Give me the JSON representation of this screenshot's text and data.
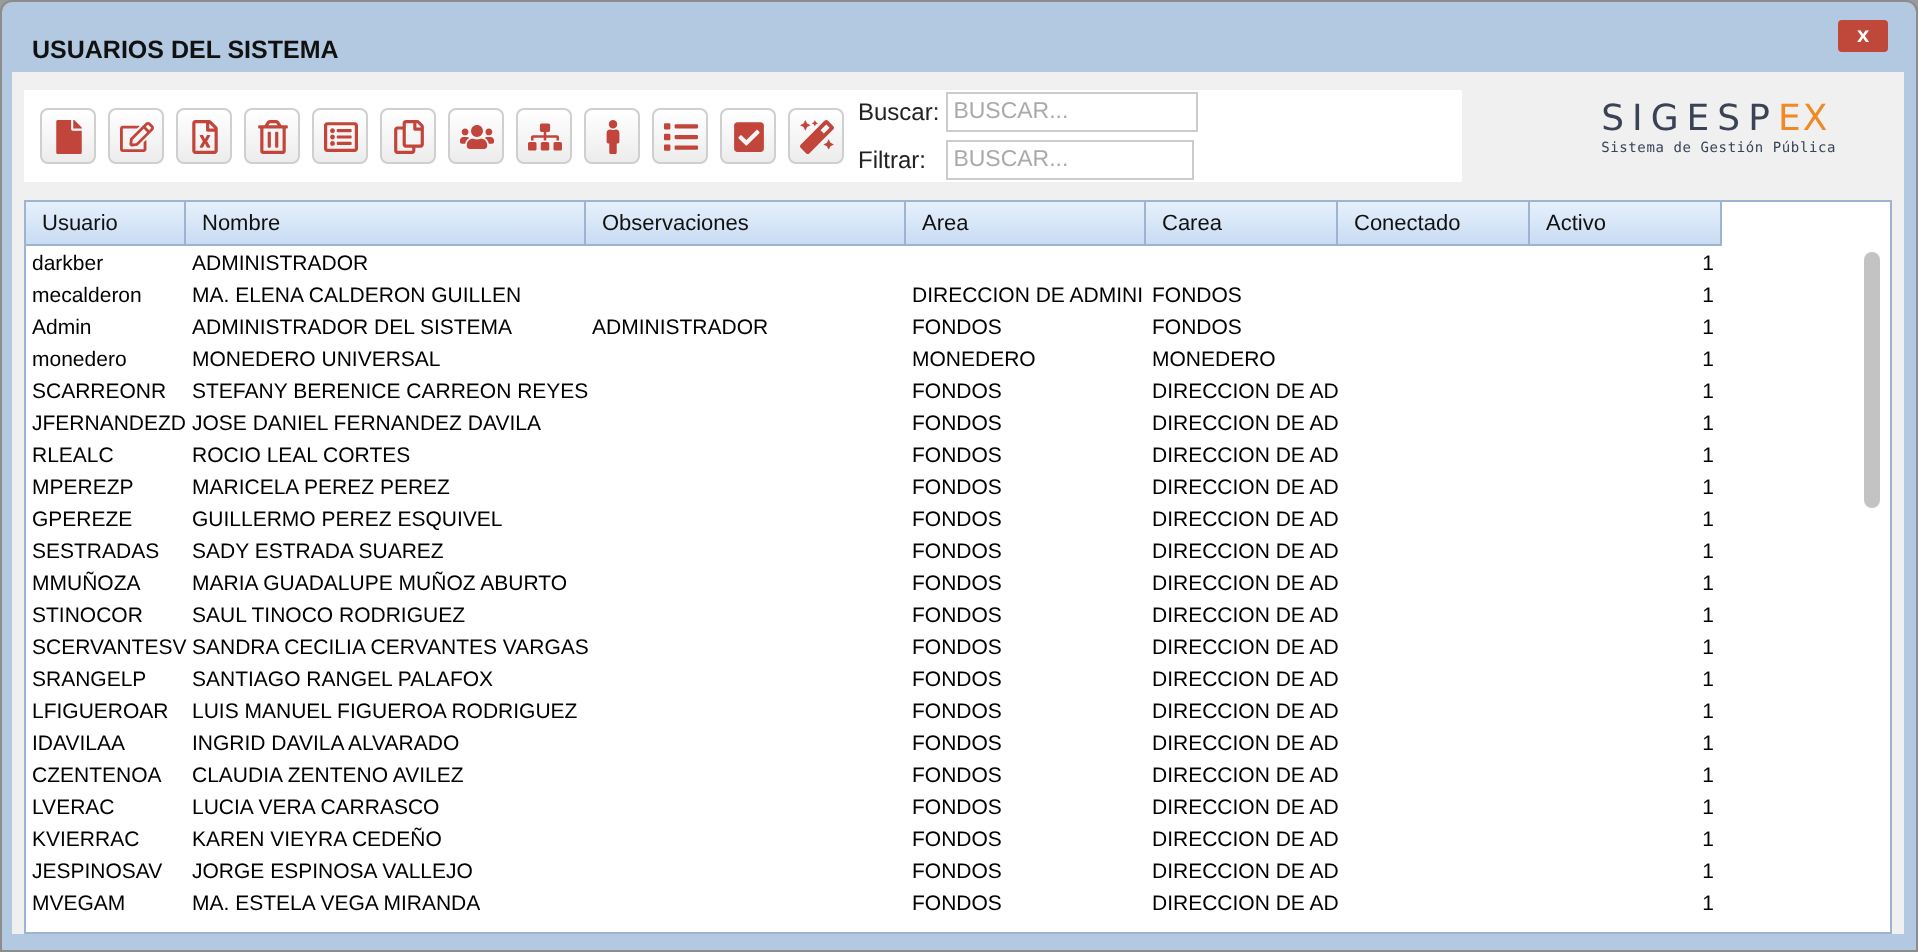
{
  "window": {
    "title": "USUARIOS DEL SISTEMA",
    "close": "x"
  },
  "toolbar": {
    "buttons": [
      {
        "kind": "new"
      },
      {
        "kind": "edit"
      },
      {
        "kind": "excel"
      },
      {
        "kind": "delete"
      },
      {
        "kind": "card"
      },
      {
        "kind": "copy"
      },
      {
        "kind": "users"
      },
      {
        "kind": "tree"
      },
      {
        "kind": "person"
      },
      {
        "kind": "list"
      },
      {
        "kind": "check"
      },
      {
        "kind": "wand"
      }
    ],
    "search": {
      "label": "Buscar:",
      "placeholder": "BUSCAR..."
    },
    "filter": {
      "label": "Filtrar:",
      "placeholder": "BUSCAR..."
    }
  },
  "logo": {
    "name": "SIGESP",
    "suffix": "EX",
    "tagline": "Sistema de Gestión Pública"
  },
  "table": {
    "columns": [
      "Usuario",
      "Nombre",
      "Observaciones",
      "Area",
      "Carea",
      "Conectado",
      "Activo"
    ],
    "rows": [
      {
        "usuario": "darkber",
        "nombre": "ADMINISTRADOR",
        "activo": "1"
      },
      {
        "usuario": "mecalderon",
        "nombre": "MA. ELENA CALDERON GUILLEN",
        "area": "DIRECCION DE ADMINI",
        "carea": "FONDOS",
        "activo": "1"
      },
      {
        "usuario": "Admin",
        "nombre": "ADMINISTRADOR DEL SISTEMA",
        "observaciones": "ADMINISTRADOR",
        "area": "FONDOS",
        "carea": "FONDOS",
        "activo": "1"
      },
      {
        "usuario": "monedero",
        "nombre": "MONEDERO UNIVERSAL",
        "area": "MONEDERO",
        "carea": "MONEDERO",
        "activo": "1"
      },
      {
        "usuario": "SCARREONR",
        "nombre": "STEFANY BERENICE CARREON REYES",
        "area": "FONDOS",
        "carea": "DIRECCION DE AD",
        "activo": "1"
      },
      {
        "usuario": "JFERNANDEZD",
        "nombre": "JOSE DANIEL FERNANDEZ DAVILA",
        "area": "FONDOS",
        "carea": "DIRECCION DE AD",
        "activo": "1"
      },
      {
        "usuario": "RLEALC",
        "nombre": "ROCIO LEAL CORTES",
        "area": "FONDOS",
        "carea": "DIRECCION DE AD",
        "activo": "1"
      },
      {
        "usuario": "MPEREZP",
        "nombre": "MARICELA PEREZ PEREZ",
        "area": "FONDOS",
        "carea": "DIRECCION DE AD",
        "activo": "1"
      },
      {
        "usuario": "GPEREZE",
        "nombre": "GUILLERMO PEREZ ESQUIVEL",
        "area": "FONDOS",
        "carea": "DIRECCION DE AD",
        "activo": "1"
      },
      {
        "usuario": "SESTRADAS",
        "nombre": "SADY ESTRADA SUAREZ",
        "area": "FONDOS",
        "carea": "DIRECCION DE AD",
        "activo": "1"
      },
      {
        "usuario": "MMUÑOZA",
        "nombre": "MARIA GUADALUPE MUÑOZ ABURTO",
        "area": "FONDOS",
        "carea": "DIRECCION DE AD",
        "activo": "1"
      },
      {
        "usuario": "STINOCOR",
        "nombre": "SAUL TINOCO RODRIGUEZ",
        "area": "FONDOS",
        "carea": "DIRECCION DE AD",
        "activo": "1"
      },
      {
        "usuario": "SCERVANTESV",
        "nombre": "SANDRA CECILIA CERVANTES VARGAS",
        "area": "FONDOS",
        "carea": "DIRECCION DE AD",
        "activo": "1"
      },
      {
        "usuario": "SRANGELP",
        "nombre": "SANTIAGO RANGEL PALAFOX",
        "area": "FONDOS",
        "carea": "DIRECCION DE AD",
        "activo": "1"
      },
      {
        "usuario": "LFIGUEROAR",
        "nombre": "LUIS MANUEL FIGUEROA RODRIGUEZ",
        "area": "FONDOS",
        "carea": "DIRECCION DE AD",
        "activo": "1"
      },
      {
        "usuario": "IDAVILAA",
        "nombre": "INGRID DAVILA ALVARADO",
        "area": "FONDOS",
        "carea": "DIRECCION DE AD",
        "activo": "1"
      },
      {
        "usuario": "CZENTENOA",
        "nombre": "CLAUDIA ZENTENO AVILEZ",
        "area": "FONDOS",
        "carea": "DIRECCION DE AD",
        "activo": "1"
      },
      {
        "usuario": "LVERAC",
        "nombre": "LUCIA VERA CARRASCO",
        "area": "FONDOS",
        "carea": "DIRECCION DE AD",
        "activo": "1"
      },
      {
        "usuario": "KVIERRAC",
        "nombre": "KAREN VIEYRA CEDEÑO",
        "area": "FONDOS",
        "carea": "DIRECCION DE AD",
        "activo": "1"
      },
      {
        "usuario": "JESPINOSAV",
        "nombre": "JORGE ESPINOSA VALLEJO",
        "area": "FONDOS",
        "carea": "DIRECCION DE AD",
        "activo": "1"
      },
      {
        "usuario": "MVEGAM",
        "nombre": "MA. ESTELA VEGA MIRANDA",
        "area": "FONDOS",
        "carea": "DIRECCION DE AD",
        "activo": "1"
      }
    ]
  }
}
